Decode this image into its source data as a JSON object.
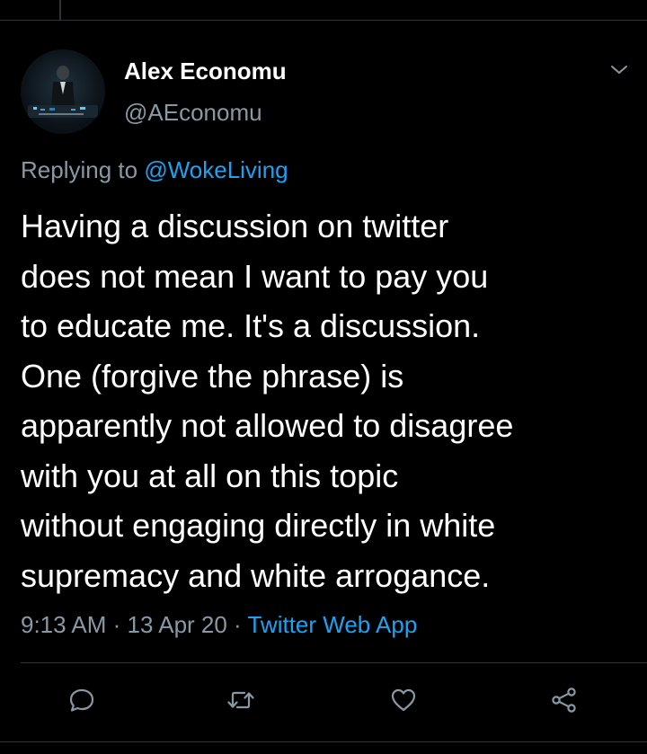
{
  "tweet": {
    "author_name": "Alex Economu",
    "author_handle": "@AEconomu",
    "replying_prefix": "Replying to ",
    "replying_to": "@WokeLiving",
    "text": "Having a discussion on twitter\ndoes not mean I want to pay you\nto educate me.  It's a discussion.\nOne (forgive the phrase) is\napparently not allowed to disagree\nwith you at all on this topic\nwithout engaging directly in white\nsupremacy and white arrogance.",
    "time": "9:13 AM",
    "date": "13 Apr 20",
    "separator": " · ",
    "source": "Twitter Web App"
  },
  "icons": {
    "more": "chevron-down-icon",
    "reply": "reply-bubble-icon",
    "retweet": "retweet-icon",
    "like": "heart-icon",
    "share": "share-icon"
  },
  "colors": {
    "background": "#000000",
    "primary_text": "#ffffff",
    "secondary_text": "#8899a6",
    "accent": "#1da1f2",
    "divider": "#2f3336"
  }
}
